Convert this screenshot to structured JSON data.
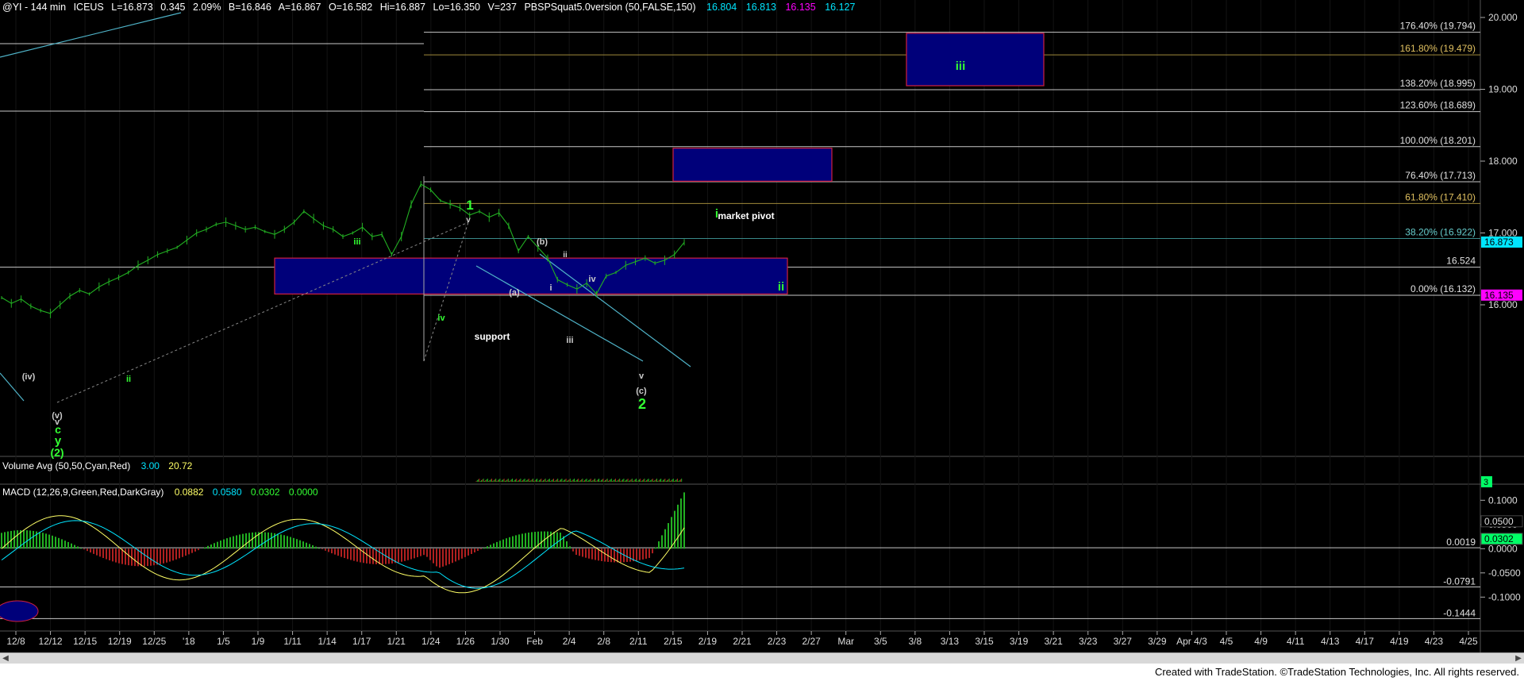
{
  "header": {
    "symbol": "@YI - 144 min",
    "exchange": "ICEUS",
    "last": "L=16.873",
    "chg": "0.345",
    "pct": "2.09%",
    "bid": "B=16.846",
    "ask": "A=16.867",
    "open": "O=16.582",
    "high": "Hi=16.887",
    "low": "Lo=16.350",
    "vol": "V=237",
    "study": "PBSPSquat5.0version (50,FALSE,150)",
    "study_vals": [
      "16.804",
      "16.813",
      "16.135",
      "16.127"
    ],
    "colors": {
      "text": "#ffffff",
      "study": "#00e5ff",
      "magenta": "#ff00ff"
    }
  },
  "volume_panel": {
    "title": "Volume Avg (50,50,Cyan,Red)",
    "val1": "3.00",
    "val2": "20.72",
    "axis_label": "3"
  },
  "macd_panel": {
    "title": "MACD (12,26,9,Green,Red,DarkGray)",
    "vals": [
      "0.0882",
      "0.0580",
      "0.0302",
      "0.0000"
    ],
    "axis_ticks": [
      "0.1000",
      "0.0500",
      "0.0000",
      "-0.0500",
      "-0.1000"
    ],
    "right_tags": [
      "0.0500",
      "0.0302"
    ],
    "levels": [
      "0.0019",
      "-0.0791",
      "-0.1444"
    ]
  },
  "chart_data": {
    "type": "line",
    "title": "@YI - 144 min",
    "xlabel": "",
    "ylabel": "",
    "ylim": [
      15.2,
      20.1
    ],
    "x_ticks": [
      "12/8",
      "12/12",
      "12/15",
      "12/19",
      "12/25",
      "'18",
      "1/5",
      "1/9",
      "1/11",
      "1/14",
      "1/17",
      "1/21",
      "1/24",
      "1/26",
      "1/30",
      "Feb",
      "2/4",
      "2/8",
      "2/11",
      "2/15",
      "2/19",
      "2/21",
      "2/23",
      "2/27",
      "Mar",
      "3/5",
      "3/8",
      "3/13",
      "3/15",
      "3/19",
      "3/21",
      "3/23",
      "3/27",
      "3/29",
      "Apr 4/3",
      "4/5",
      "4/9",
      "4/11",
      "4/13",
      "4/17",
      "4/19",
      "4/23",
      "4/25"
    ],
    "y_ticks": [
      "20.000",
      "19.000",
      "18.000",
      "17.000",
      "16.000"
    ],
    "price_series": [
      [
        0,
        16.1
      ],
      [
        3,
        16.02
      ],
      [
        6,
        16.08
      ],
      [
        9,
        15.98
      ],
      [
        12,
        15.92
      ],
      [
        15,
        15.88
      ],
      [
        18,
        16.0
      ],
      [
        21,
        16.12
      ],
      [
        24,
        16.2
      ],
      [
        27,
        16.15
      ],
      [
        30,
        16.25
      ],
      [
        33,
        16.32
      ],
      [
        36,
        16.38
      ],
      [
        39,
        16.45
      ],
      [
        42,
        16.55
      ],
      [
        45,
        16.62
      ],
      [
        48,
        16.7
      ],
      [
        51,
        16.75
      ],
      [
        54,
        16.8
      ],
      [
        57,
        16.9
      ],
      [
        60,
        17.0
      ],
      [
        63,
        17.05
      ],
      [
        66,
        17.12
      ],
      [
        69,
        17.15
      ],
      [
        72,
        17.1
      ],
      [
        75,
        17.05
      ],
      [
        78,
        17.08
      ],
      [
        81,
        17.02
      ],
      [
        84,
        16.98
      ],
      [
        87,
        17.05
      ],
      [
        90,
        17.15
      ],
      [
        93,
        17.3
      ],
      [
        96,
        17.2
      ],
      [
        99,
        17.1
      ],
      [
        102,
        17.05
      ],
      [
        105,
        16.95
      ],
      [
        108,
        17.0
      ],
      [
        111,
        17.08
      ],
      [
        114,
        16.95
      ],
      [
        117,
        16.98
      ],
      [
        120,
        16.7
      ],
      [
        123,
        16.95
      ],
      [
        126,
        17.4
      ],
      [
        129,
        17.68
      ],
      [
        132,
        17.6
      ],
      [
        135,
        17.45
      ],
      [
        138,
        17.4
      ],
      [
        141,
        17.35
      ],
      [
        144,
        17.25
      ],
      [
        147,
        17.3
      ],
      [
        150,
        17.22
      ],
      [
        153,
        17.28
      ],
      [
        156,
        17.1
      ],
      [
        159,
        16.75
      ],
      [
        162,
        16.95
      ],
      [
        165,
        16.8
      ],
      [
        168,
        16.65
      ],
      [
        171,
        16.35
      ],
      [
        174,
        16.28
      ],
      [
        177,
        16.22
      ],
      [
        180,
        16.3
      ],
      [
        183,
        16.15
      ],
      [
        186,
        16.4
      ],
      [
        189,
        16.45
      ],
      [
        192,
        16.55
      ],
      [
        195,
        16.6
      ],
      [
        198,
        16.65
      ],
      [
        201,
        16.58
      ],
      [
        204,
        16.62
      ],
      [
        207,
        16.7
      ],
      [
        210,
        16.87
      ]
    ],
    "levels": [
      {
        "label": "176.40% (19.794)",
        "value": 19.794
      },
      {
        "label": "161.80% (19.479)",
        "value": 19.479
      },
      {
        "label": "138.20% (18.995)",
        "value": 18.995
      },
      {
        "label": "123.60% (18.689)",
        "value": 18.689
      },
      {
        "label": "100.00% (18.201)",
        "value": 18.201
      },
      {
        "label": "76.40% (17.713)",
        "value": 17.713
      },
      {
        "label": "61.80% (17.410)",
        "value": 17.41
      },
      {
        "label": "38.20% (16.922)",
        "value": 16.922
      },
      {
        "label": "16.524",
        "value": 16.524
      },
      {
        "label": "0.00% (16.132)",
        "value": 16.132
      }
    ],
    "price_tags": [
      {
        "label": "16.873",
        "value": 16.873,
        "color": "#00e5ff"
      },
      {
        "label": "16.135",
        "value": 16.135,
        "color": "#ff00ff"
      }
    ],
    "boxes": [
      {
        "label": "support",
        "y0": 16.15,
        "y1": 16.65,
        "x0": 0,
        "x1": 1
      },
      {
        "label": "market pivot",
        "y0": 17.72,
        "y1": 18.18,
        "x0": 0,
        "x1": 1
      },
      {
        "label": "iii",
        "y0": 19.05,
        "y1": 19.78,
        "x0": 0,
        "x1": 1
      }
    ],
    "wave_labels": [
      "(iv)",
      "(v)",
      "v",
      "c",
      "y",
      "(2)",
      "ii",
      "iii",
      "iv",
      "1",
      "v",
      "(a)",
      "(b)",
      "ii",
      "i",
      "iii",
      "iv",
      "v",
      "(c)",
      "2",
      "i",
      "ii"
    ]
  },
  "footer": {
    "text": "Created with TradeStation. ©TradeStation Technologies, Inc. All rights reserved."
  }
}
